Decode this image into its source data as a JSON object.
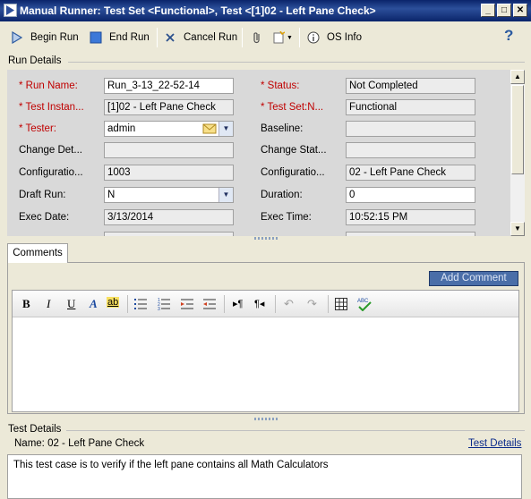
{
  "window": {
    "title": "Manual Runner: Test Set <Functional>, Test <[1]02 - Left Pane Check>"
  },
  "toolbar": {
    "begin_run": "Begin Run",
    "end_run": "End Run",
    "cancel_run": "Cancel Run",
    "os_info": "OS Info",
    "help_glyph": "?"
  },
  "run_details": {
    "header": "Run Details",
    "left": [
      {
        "label": "* Run Name:",
        "value": "Run_3-13_22-52-14",
        "required": true
      },
      {
        "label": "* Test Instan...",
        "value": "[1]02 - Left Pane Check",
        "required": true
      },
      {
        "label": "* Tester:",
        "value": "admin",
        "required": true
      },
      {
        "label": "Change Det...",
        "value": "",
        "required": false
      },
      {
        "label": "Configuratio...",
        "value": "1003",
        "required": false
      },
      {
        "label": "Draft Run:",
        "value": "N",
        "required": false
      },
      {
        "label": "Exec Date:",
        "value": "3/13/2014",
        "required": false
      }
    ],
    "right": [
      {
        "label": "* Status:",
        "value": "Not Completed",
        "required": true
      },
      {
        "label": "* Test Set:N...",
        "value": "Functional",
        "required": true
      },
      {
        "label": "Baseline:",
        "value": "",
        "required": false
      },
      {
        "label": "Change Stat...",
        "value": "",
        "required": false
      },
      {
        "label": "Configuratio...",
        "value": "02 - Left Pane Check",
        "required": false
      },
      {
        "label": "Duration:",
        "value": "0",
        "required": false
      },
      {
        "label": "Exec Time:",
        "value": "10:52:15 PM",
        "required": false
      }
    ]
  },
  "comments": {
    "tab": "Comments",
    "add_button": "Add Comment",
    "format_bold": "B",
    "format_italic": "I",
    "format_underline": "U",
    "format_font": "A",
    "format_highlight": "ab",
    "spell_glyph": "ABC"
  },
  "test_details": {
    "header": "Test Details",
    "name": "Name: 02 - Left Pane Check",
    "link": "Test Details",
    "description": "This test case is to verify if the left pane contains all Math Calculators"
  },
  "colors": {
    "title_bar": "#0a246a",
    "required_label": "#c00000",
    "add_comment_bg": "#4a6ea8",
    "link": "#0a2a8a"
  }
}
